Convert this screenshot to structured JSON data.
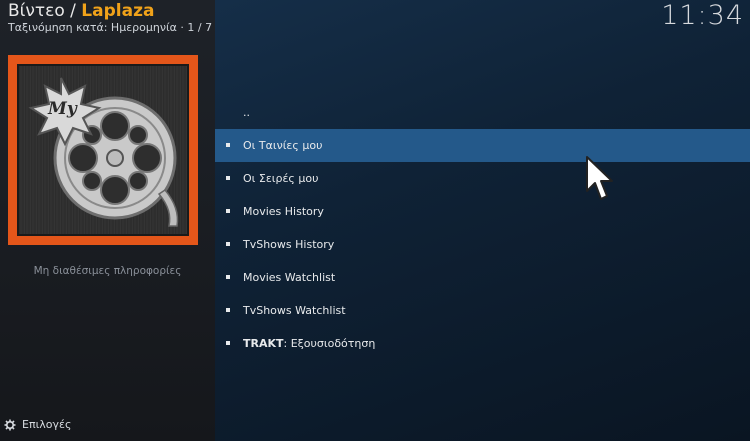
{
  "header": {
    "section": "Βίντεο",
    "separator": "/",
    "addon_name": "Laplaza",
    "sort_info": "Ταξινόμηση κατά: Ημερομηνία · 1 / 7",
    "clock": "11:34"
  },
  "thumbnail": {
    "logo_text": "My",
    "icon": "film-reel-icon",
    "frame_color": "#e4561a"
  },
  "no_info_text": "Μη διαθέσιμες πληροφορίες",
  "options_label": "Επιλογές",
  "list": {
    "items": [
      {
        "label": ".."
      },
      {
        "label": "Οι Ταινίες μου",
        "selected": true
      },
      {
        "label": "Οι Σειρές μου"
      },
      {
        "label": "Movies History"
      },
      {
        "label": "TvShows History"
      },
      {
        "label": "Movies Watchlist"
      },
      {
        "label": "TvShows Watchlist"
      },
      {
        "label_bold": "TRAKT",
        "label_rest": ": Εξουσιοδότηση"
      }
    ]
  },
  "colors": {
    "accent": "#f0a21a",
    "selection": "#24598a"
  }
}
